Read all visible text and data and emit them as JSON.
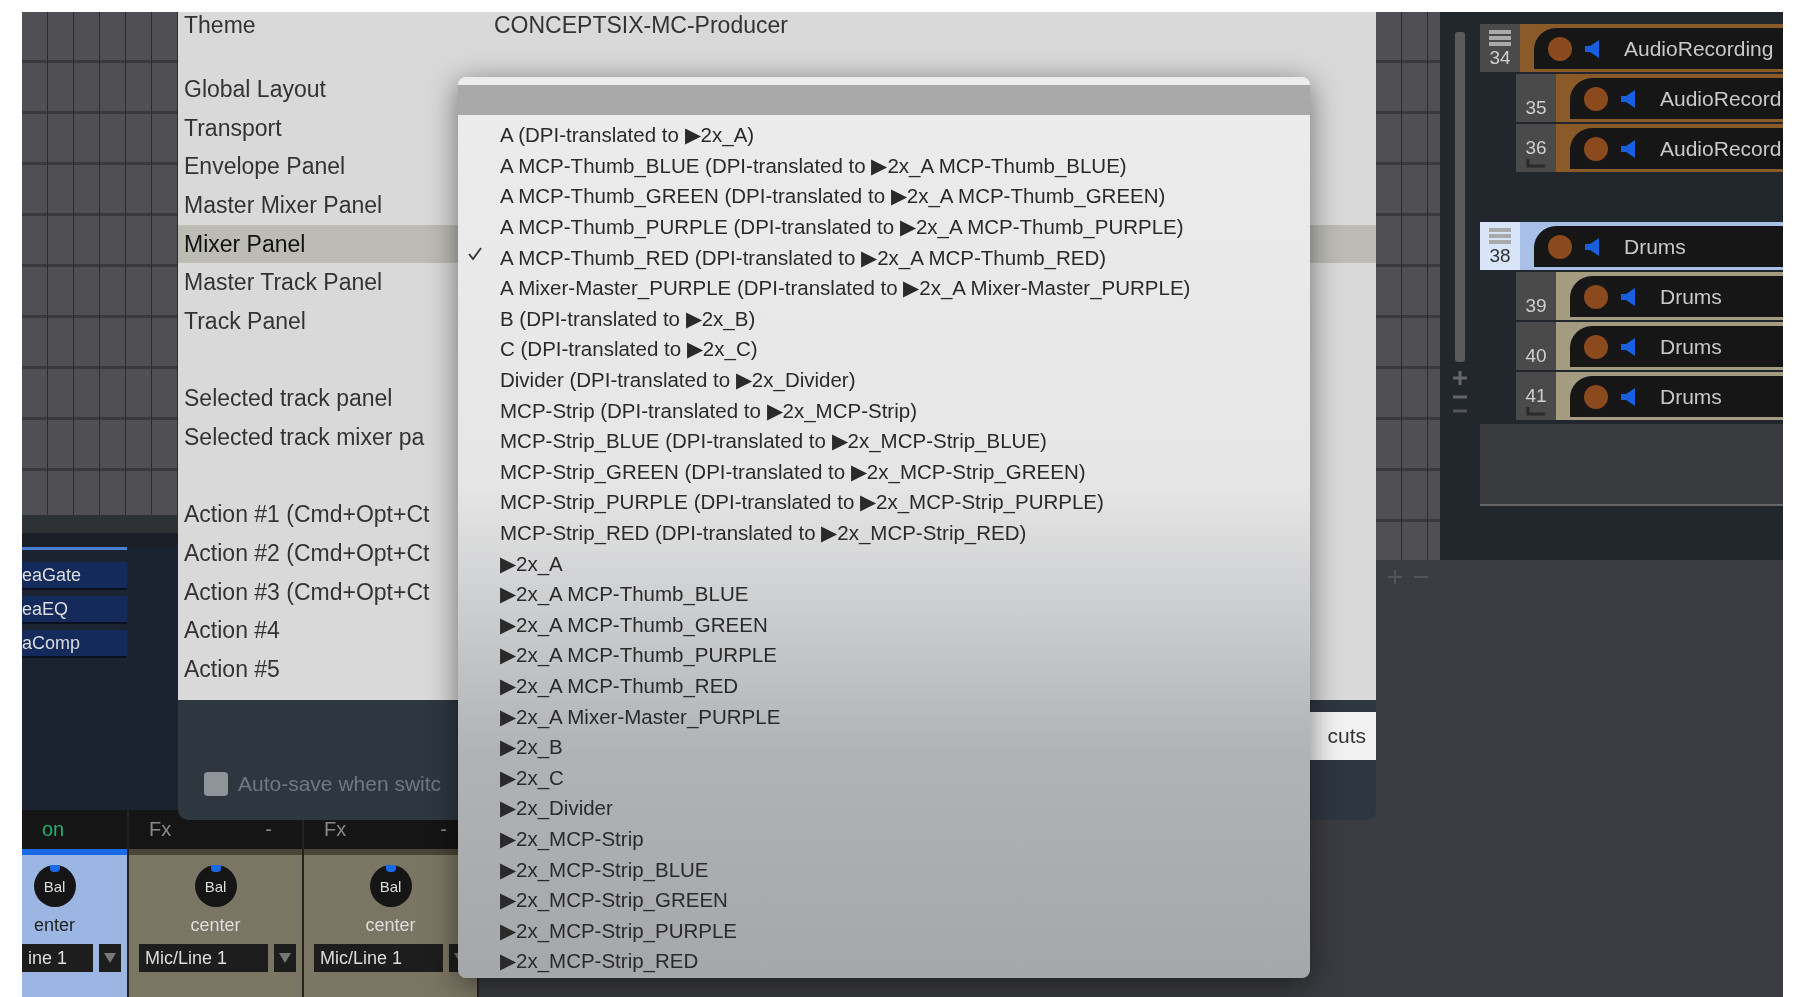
{
  "dialog": {
    "theme_label": "Theme",
    "theme_value": "CONCEPTSIX-MC-Producer",
    "sections": [
      {
        "label": "Global Layout",
        "selected": false,
        "gap_before": false
      },
      {
        "label": "Transport",
        "selected": false,
        "gap_before": false
      },
      {
        "label": "Envelope Panel",
        "selected": false,
        "gap_before": false
      },
      {
        "label": "Master Mixer Panel",
        "selected": false,
        "gap_before": false
      },
      {
        "label": "Mixer Panel",
        "selected": true,
        "gap_before": false
      },
      {
        "label": "Master Track Panel",
        "selected": false,
        "gap_before": false
      },
      {
        "label": "Track Panel",
        "selected": false,
        "gap_before": false
      },
      {
        "label": "Selected track panel",
        "selected": false,
        "gap_before": true
      },
      {
        "label": "Selected track mixer pa",
        "selected": false,
        "gap_before": false
      },
      {
        "label": "Action #1 (Cmd+Opt+Ct",
        "selected": false,
        "gap_before": true
      },
      {
        "label": "Action #2 (Cmd+Opt+Ct",
        "selected": false,
        "gap_before": false
      },
      {
        "label": "Action #3 (Cmd+Opt+Ct",
        "selected": false,
        "gap_before": false
      },
      {
        "label": "Action #4",
        "selected": false,
        "gap_before": false
      },
      {
        "label": "Action #5",
        "selected": false,
        "gap_before": false
      }
    ],
    "autosave": {
      "label": "Auto-save when switc",
      "checked": false,
      "disabled": true
    },
    "shortcuts_button": "cuts"
  },
  "menu": {
    "items": [
      {
        "label": "A (DPI-translated to ▶2x_A)",
        "checked": false
      },
      {
        "label": "A MCP-Thumb_BLUE (DPI-translated to ▶2x_A MCP-Thumb_BLUE)",
        "checked": false
      },
      {
        "label": "A MCP-Thumb_GREEN (DPI-translated to ▶2x_A MCP-Thumb_GREEN)",
        "checked": false
      },
      {
        "label": "A MCP-Thumb_PURPLE (DPI-translated to ▶2x_A MCP-Thumb_PURPLE)",
        "checked": false
      },
      {
        "label": "A MCP-Thumb_RED (DPI-translated to ▶2x_A MCP-Thumb_RED)",
        "checked": true
      },
      {
        "label": "A Mixer-Master_PURPLE (DPI-translated to ▶2x_A Mixer-Master_PURPLE)",
        "checked": false
      },
      {
        "label": "B (DPI-translated to ▶2x_B)",
        "checked": false
      },
      {
        "label": "C (DPI-translated to ▶2x_C)",
        "checked": false
      },
      {
        "label": "Divider (DPI-translated to ▶2x_Divider)",
        "checked": false
      },
      {
        "label": "MCP-Strip (DPI-translated to ▶2x_MCP-Strip)",
        "checked": false
      },
      {
        "label": "MCP-Strip_BLUE (DPI-translated to ▶2x_MCP-Strip_BLUE)",
        "checked": false
      },
      {
        "label": "MCP-Strip_GREEN (DPI-translated to ▶2x_MCP-Strip_GREEN)",
        "checked": false
      },
      {
        "label": "MCP-Strip_PURPLE (DPI-translated to ▶2x_MCP-Strip_PURPLE)",
        "checked": false
      },
      {
        "label": "MCP-Strip_RED (DPI-translated to ▶2x_MCP-Strip_RED)",
        "checked": false
      },
      {
        "label": "▶2x_A",
        "checked": false
      },
      {
        "label": "▶2x_A MCP-Thumb_BLUE",
        "checked": false
      },
      {
        "label": "▶2x_A MCP-Thumb_GREEN",
        "checked": false
      },
      {
        "label": "▶2x_A MCP-Thumb_PURPLE",
        "checked": false
      },
      {
        "label": "▶2x_A MCP-Thumb_RED",
        "checked": false
      },
      {
        "label": "▶2x_A Mixer-Master_PURPLE",
        "checked": false
      },
      {
        "label": "▶2x_B",
        "checked": false
      },
      {
        "label": "▶2x_C",
        "checked": false
      },
      {
        "label": "▶2x_Divider",
        "checked": false
      },
      {
        "label": "▶2x_MCP-Strip",
        "checked": false
      },
      {
        "label": "▶2x_MCP-Strip_BLUE",
        "checked": false
      },
      {
        "label": "▶2x_MCP-Strip_GREEN",
        "checked": false
      },
      {
        "label": "▶2x_MCP-Strip_PURPLE",
        "checked": false
      },
      {
        "label": "▶2x_MCP-Strip_RED",
        "checked": false
      }
    ]
  },
  "fx_list": [
    "eaGate",
    "eaEQ",
    "aComp"
  ],
  "tracks": [
    {
      "number": "34",
      "name": "AudioRecording",
      "color": "#8a5a28",
      "selected": false,
      "children": [
        {
          "number": "35",
          "name": "AudioRecord",
          "color": "#8a5a28",
          "selected": false
        },
        {
          "number": "36",
          "name": "AudioRecord",
          "color": "#8a5a28",
          "selected": false
        }
      ]
    },
    {
      "number": "38",
      "name": "Drums",
      "color": "#a8c0e8",
      "selected": true,
      "children": [
        {
          "number": "39",
          "name": "Drums",
          "color": "#a49c80",
          "selected": false
        },
        {
          "number": "40",
          "name": "Drums",
          "color": "#a49c80",
          "selected": false
        },
        {
          "number": "41",
          "name": "Drums",
          "color": "#a49c80",
          "selected": false
        }
      ]
    }
  ],
  "strips": [
    {
      "selected": true,
      "header_right": "on",
      "knob": "Bal",
      "pan": "enter",
      "input": "ine 1"
    },
    {
      "selected": false,
      "header_left": "Fx",
      "header_right": "-",
      "knob": "Bal",
      "pan": "center",
      "input": "Mic/Line 1"
    },
    {
      "selected": false,
      "header_left": "Fx",
      "header_right": "-",
      "knob": "Bal",
      "pan": "center",
      "input": "Mic/Line 1"
    }
  ]
}
